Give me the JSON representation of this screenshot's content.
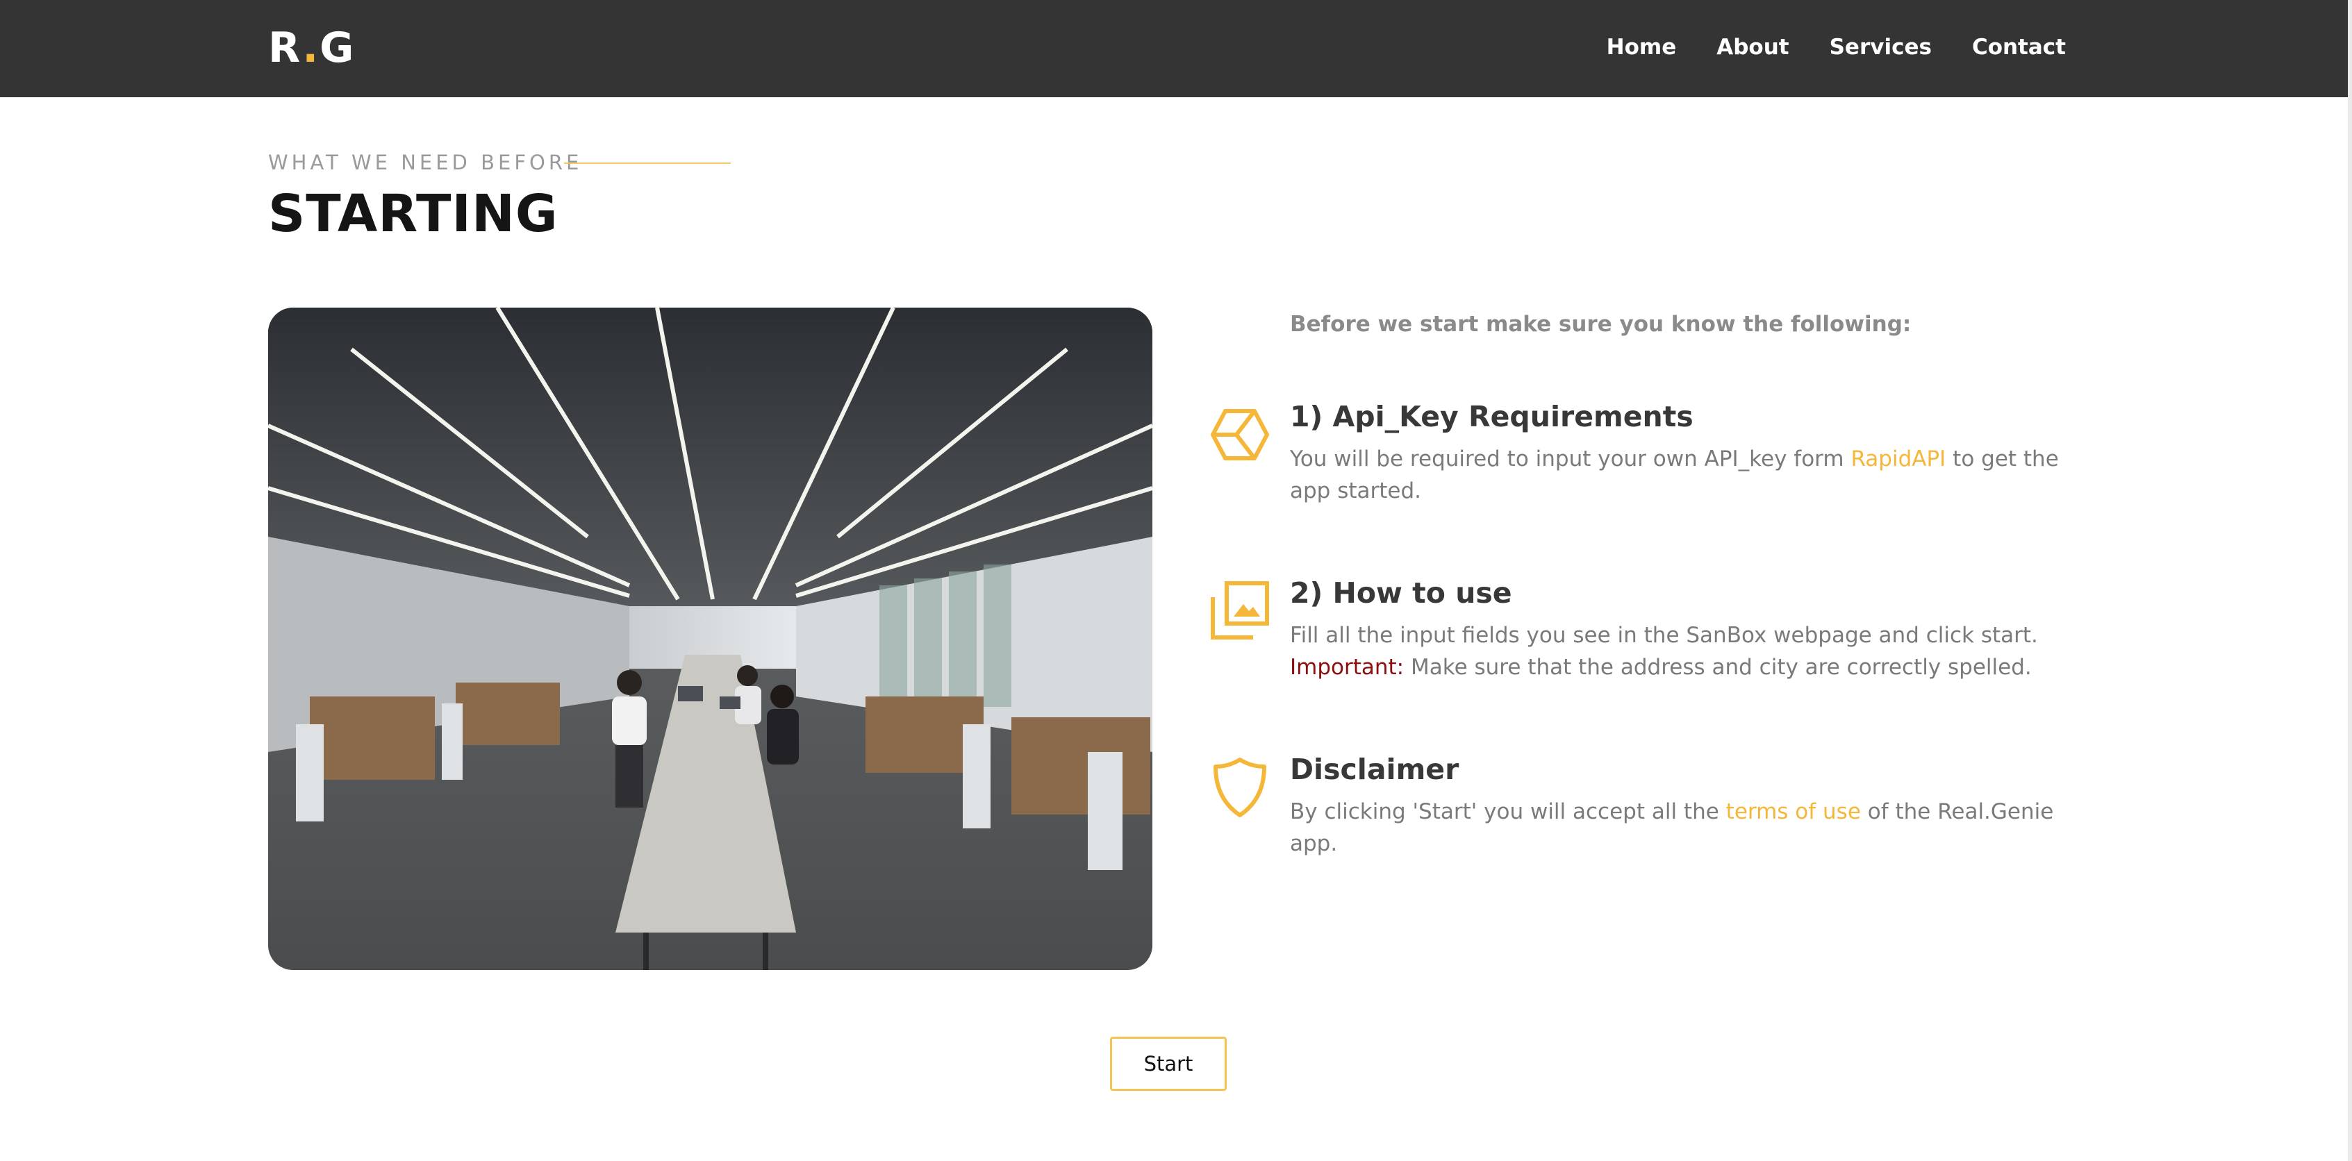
{
  "nav": {
    "logo_left": "R",
    "logo_dot": ".",
    "logo_right": "G",
    "links": [
      "Home",
      "About",
      "Services",
      "Contact"
    ]
  },
  "section": {
    "kicker": "WHAT WE NEED BEFORE",
    "title": "STARTING"
  },
  "content": {
    "intro": "Before we start make sure you know the following:",
    "features": [
      {
        "icon": "cube-icon",
        "title": "1) Api_Key Requirements",
        "text_before": "You will be required to input your own API_key form ",
        "link": "RapidAPI",
        "text_after": " to get the app started."
      },
      {
        "icon": "images-icon",
        "title": "2) How to use",
        "text": "Fill all the input fields you see in the SanBox webpage and click start.",
        "important_label": "Important:",
        "important_text": " Make sure that the address and city are correctly spelled."
      },
      {
        "icon": "shield-icon",
        "title": "Disclaimer",
        "text_before": "By clicking 'Start' you will accept all the ",
        "link": "terms of use",
        "text_after": " of the Real.Genie app."
      }
    ]
  },
  "actions": {
    "start_label": "Start"
  },
  "colors": {
    "accent": "#f5b73a",
    "navbar": "#343434",
    "important": "#8b0f0f"
  }
}
